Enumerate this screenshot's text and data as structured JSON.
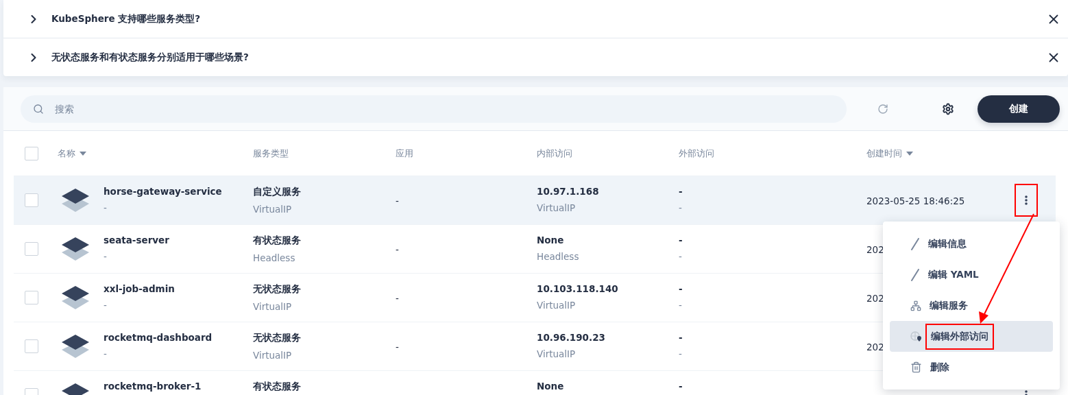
{
  "faq": [
    {
      "question": "KubeSphere 支持哪些服务类型?",
      "expanded": false
    },
    {
      "question": "无状态服务和有状态服务分别适用于哪些场景?",
      "expanded": false
    }
  ],
  "toolbar": {
    "search": {
      "placeholder": "搜索"
    },
    "create_button": "创建"
  },
  "table": {
    "header_checked": false,
    "columns": [
      {
        "label": "名称",
        "sortable": true
      },
      {
        "label": "服务类型",
        "sortable": false
      },
      {
        "label": "应用",
        "sortable": false
      },
      {
        "label": "内部访问",
        "sortable": false
      },
      {
        "label": "外部访问",
        "sortable": false
      },
      {
        "label": "创建时间",
        "sortable": true
      }
    ],
    "rows": [
      {
        "name": "horse-gateway-service",
        "description": "-",
        "type": "自定义服务",
        "type_sub": "VirtualIP",
        "app": "-",
        "internal": "10.97.1.168",
        "internal_sub": "VirtualIP",
        "external": "-",
        "external_sub": "-",
        "created": "2023-05-25 18:46:25",
        "checked": false,
        "highlighted": true,
        "annotated": true
      },
      {
        "name": "seata-server",
        "description": "-",
        "type": "有状态服务",
        "type_sub": "Headless",
        "app": "-",
        "internal": "None",
        "internal_sub": "Headless",
        "external": "-",
        "external_sub": "-",
        "created": "202",
        "checked": false,
        "highlighted": false
      },
      {
        "name": "xxl-job-admin",
        "description": "-",
        "type": "无状态服务",
        "type_sub": "VirtualIP",
        "app": "-",
        "internal": "10.103.118.140",
        "internal_sub": "VirtualIP",
        "external": "-",
        "external_sub": "-",
        "created": "202",
        "checked": false,
        "highlighted": false
      },
      {
        "name": "rocketmq-dashboard",
        "description": "-",
        "type": "无状态服务",
        "type_sub": "VirtualIP",
        "app": "-",
        "internal": "10.96.190.23",
        "internal_sub": "VirtualIP",
        "external": "-",
        "external_sub": "-",
        "created": "202",
        "checked": false,
        "highlighted": false
      },
      {
        "name": "rocketmq-broker-1",
        "type": "有状态服务",
        "internal": "None",
        "external": "-",
        "checked": false,
        "highlighted": false
      }
    ]
  },
  "row_menu": {
    "items": [
      {
        "label": "编辑信息",
        "kind": "pencil",
        "selected": false,
        "annotated": false
      },
      {
        "label": "编辑 YAML",
        "kind": "pencil",
        "selected": false,
        "annotated": false
      },
      {
        "label": "编辑服务",
        "kind": "network",
        "selected": false,
        "annotated": false
      },
      {
        "label": "编辑外部访问",
        "kind": "globe",
        "selected": true,
        "annotated": true
      },
      {
        "label": "删除",
        "kind": "trash",
        "selected": false,
        "annotated": false
      }
    ]
  },
  "annotation": {
    "arrow": true
  }
}
